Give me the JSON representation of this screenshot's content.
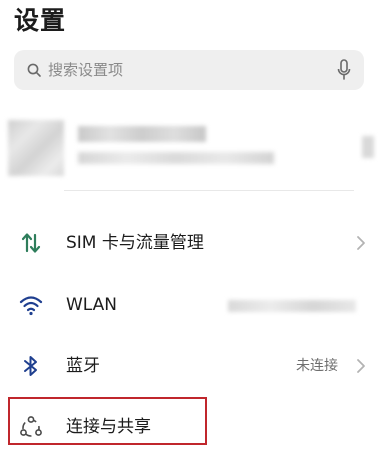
{
  "header": {
    "title": "设置"
  },
  "search": {
    "placeholder": "搜索设置项",
    "icon": "search-icon",
    "voice_icon": "microphone-icon"
  },
  "menu": {
    "items": [
      {
        "label": "SIM 卡与流量管理",
        "icon": "sim-data-arrows-icon",
        "icon_color": "#2e7d5b",
        "has_chevron": true
      },
      {
        "label": "WLAN",
        "icon": "wifi-icon",
        "icon_color": "#1f3f8f",
        "has_chevron": false
      },
      {
        "label": "蓝牙",
        "icon": "bluetooth-icon",
        "icon_color": "#1f3f8f",
        "value": "未连接",
        "has_chevron": true
      },
      {
        "label": "连接与共享",
        "icon": "connection-share-icon",
        "icon_color": "#4a4a4a",
        "has_chevron": false
      }
    ]
  },
  "annotation": {
    "highlight_color": "#c0262c"
  }
}
